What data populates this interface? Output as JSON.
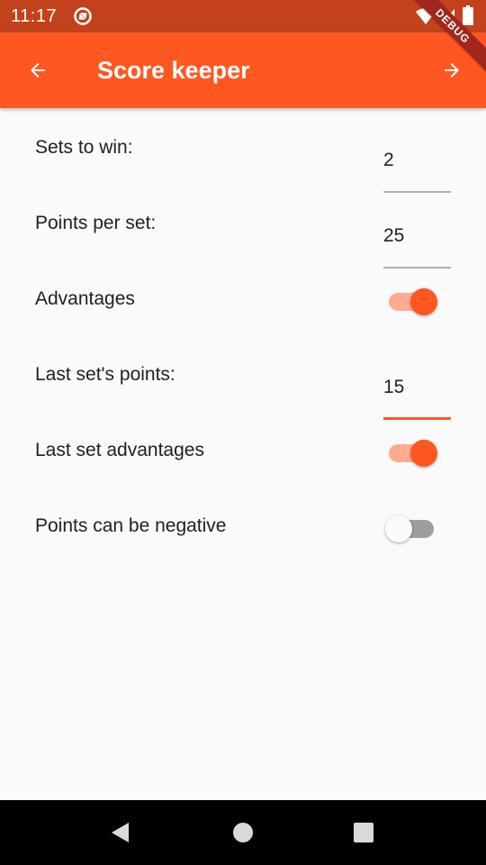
{
  "status_bar": {
    "time": "11:17",
    "icons": [
      "notification-icon",
      "wifi-icon",
      "signal-icon",
      "battery-icon"
    ]
  },
  "app_bar": {
    "title": "Score keeper",
    "back_icon": "arrow-back-icon",
    "forward_icon": "arrow-forward-icon",
    "background_color": "#ff5722"
  },
  "debug_banner": {
    "label": "DEBUG"
  },
  "settings": {
    "sets_to_win": {
      "label": "Sets to win:",
      "value": "2"
    },
    "points_per_set": {
      "label": "Points per set:",
      "value": "25"
    },
    "advantages": {
      "label": "Advantages",
      "enabled": true
    },
    "last_set_points": {
      "label": "Last set's points:",
      "value": "15",
      "focused": true
    },
    "last_set_advantages": {
      "label": "Last set advantages",
      "enabled": true
    },
    "points_can_be_negative": {
      "label": "Points can be negative",
      "enabled": false
    }
  },
  "nav_bar": {
    "icons": [
      "nav-back-icon",
      "nav-home-icon",
      "nav-recents-icon"
    ]
  },
  "colors": {
    "status_bar": "#c2421b",
    "accent": "#ff5722",
    "accent_light": "#ffab91",
    "background": "#fafafa"
  }
}
